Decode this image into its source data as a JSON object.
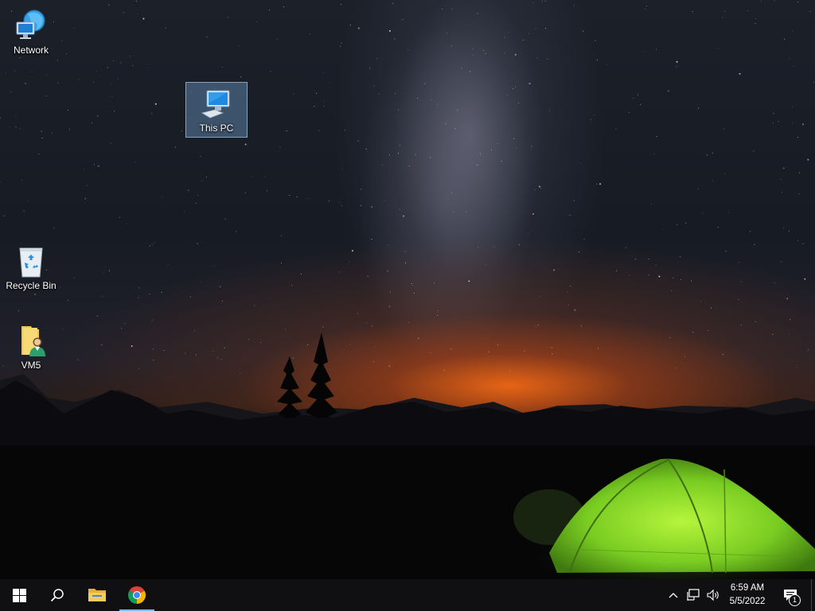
{
  "desktop": {
    "icons": [
      {
        "label": "Network"
      },
      {
        "label": "This PC"
      },
      {
        "label": "Recycle Bin"
      },
      {
        "label": "VM5"
      }
    ]
  },
  "taskbar": {
    "start_icon": "windows-logo-icon",
    "search_icon": "search-icon",
    "pinned": [
      {
        "name": "File Explorer",
        "icon": "folder-icon"
      },
      {
        "name": "Google Chrome",
        "icon": "chrome-icon",
        "active": true
      }
    ],
    "tray": {
      "show_hidden_icon": "chevron-up-icon",
      "network_icon": "network-wired-icon",
      "volume_icon": "speaker-icon",
      "time": "6:59 AM",
      "date": "5/5/2022",
      "notifications_count": "1"
    }
  },
  "colors": {
    "taskbar_bg": "#101012",
    "accent": "#76b9ed",
    "tent_green": "#7fd12a"
  }
}
